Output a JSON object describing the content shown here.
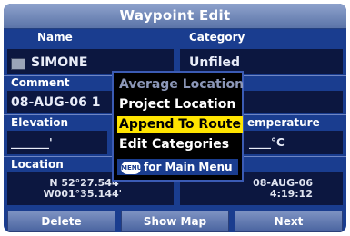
{
  "title": "Waypoint Edit",
  "fields": {
    "name_label": "Name",
    "name_value": "SIMONE",
    "category_label": "Category",
    "category_value": "Unfiled",
    "comment_label": "Comment",
    "comment_value": "08-AUG-06 1",
    "elevation_label": "Elevation",
    "elevation_value": "_______'",
    "temperature_label": "emperature",
    "temperature_value": "____°C",
    "location_label": "Location",
    "lat": "N  52°27.544'",
    "lon": "W001°35.144'",
    "date": "08-AUG-06",
    "time": "4:19:12"
  },
  "menu": {
    "items": [
      {
        "label": "Average Location",
        "state": "disabled"
      },
      {
        "label": "Project Location",
        "state": "normal"
      },
      {
        "label": "Append To Route",
        "state": "selected"
      },
      {
        "label": "Edit Categories",
        "state": "normal"
      }
    ],
    "hint_icon": "MENU",
    "hint_text": "for Main Menu"
  },
  "buttons": {
    "delete": "Delete",
    "show_map": "Show Map",
    "next": "Next"
  }
}
